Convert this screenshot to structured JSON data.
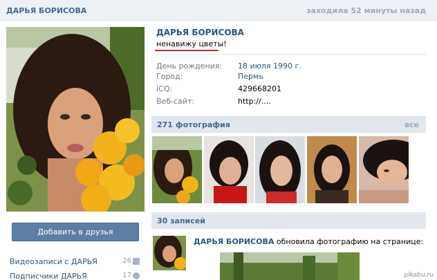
{
  "header": {
    "name": "ДАРЬЯ БОРИСОВА",
    "last_seen": "заходила 52 минуты назад"
  },
  "profile": {
    "name": "ДАРЬЯ БОРИСОВА",
    "status": "ненавижу цветы!",
    "status_underline_color": "#d51e24",
    "info": [
      {
        "label": "День рождения:",
        "value": "18 июля 1990 г.",
        "link": true
      },
      {
        "label": "Город:",
        "value": "Пермь",
        "link": true
      },
      {
        "label": "ICQ:",
        "value": "429668201",
        "link": false
      },
      {
        "label": "Веб-сайт:",
        "value": "http://....",
        "link": false
      }
    ]
  },
  "sidebar": {
    "add_friend_label": "Добавить в друзья",
    "links": [
      {
        "label": "Видеозаписи с ДАРЬЯ",
        "count": "26",
        "icon": "video-icon"
      },
      {
        "label": "Подписчики ДАРЬЯ",
        "count": "17",
        "icon": "people-icon"
      }
    ]
  },
  "photos": {
    "title": "271 фотография",
    "all_label": "все",
    "thumbs": [
      "photo-thumb-1",
      "photo-thumb-2",
      "photo-thumb-3",
      "photo-thumb-4",
      "photo-thumb-5"
    ]
  },
  "wall": {
    "title": "30 записей",
    "post": {
      "author": "ДАРЬЯ БОРИСОВА",
      "action": " обновила фотографию на странице:"
    }
  },
  "watermark": "pikabu.ru",
  "colors": {
    "brand": "#45688e",
    "link": "#2b587a",
    "header_bg": "#edf1f5",
    "section_bg": "#e1e7ed",
    "button": "#5b7fa6"
  }
}
